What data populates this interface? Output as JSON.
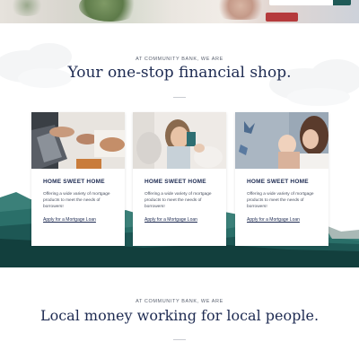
{
  "section1": {
    "eyebrow": "AT COMMUNITY BANK, WE ARE",
    "headline": "Your one-stop financial shop."
  },
  "cards": [
    {
      "title": "HOME SWEET HOME",
      "description": "Offering a wide variety of mortgage products to meet the needs of borrowers!",
      "link": "Apply for a Mortgage Loan"
    },
    {
      "title": "HOME SWEET HOME",
      "description": "Offering a wide variety of mortgage products to meet the needs of borrowers!",
      "link": "Apply for a Mortgage Loan"
    },
    {
      "title": "HOME SWEET HOME",
      "description": "Offering a wide variety of mortgage products to meet the needs of borrowers!",
      "link": "Apply for a Mortgage Loan"
    }
  ],
  "section2": {
    "eyebrow": "AT COMMUNITY BANK, WE ARE",
    "headline": "Local money working for local people."
  },
  "colors": {
    "navy": "#1e2b52",
    "teal": "#1f5a57",
    "dark_teal": "#123f3d"
  }
}
